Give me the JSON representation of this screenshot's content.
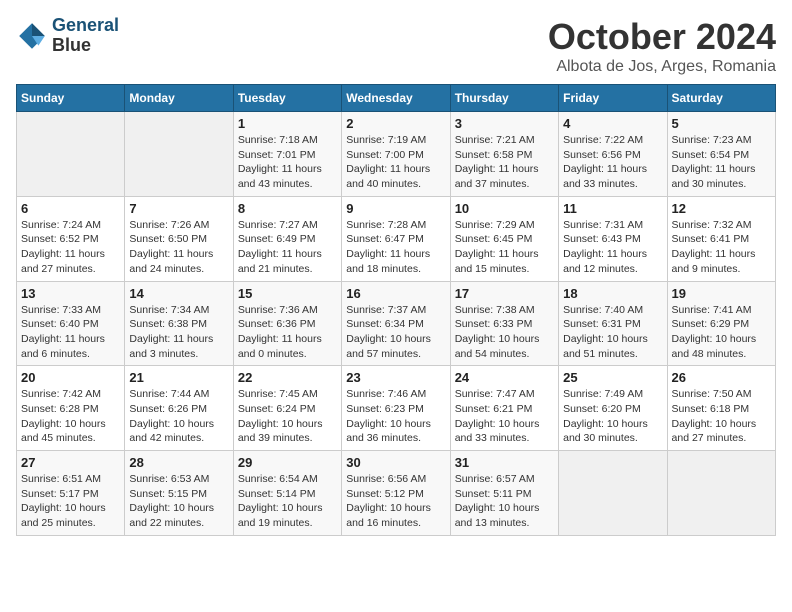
{
  "header": {
    "logo_line1": "General",
    "logo_line2": "Blue",
    "month": "October 2024",
    "location": "Albota de Jos, Arges, Romania"
  },
  "weekdays": [
    "Sunday",
    "Monday",
    "Tuesday",
    "Wednesday",
    "Thursday",
    "Friday",
    "Saturday"
  ],
  "weeks": [
    [
      {
        "day": "",
        "info": ""
      },
      {
        "day": "",
        "info": ""
      },
      {
        "day": "1",
        "info": "Sunrise: 7:18 AM\nSunset: 7:01 PM\nDaylight: 11 hours and 43 minutes."
      },
      {
        "day": "2",
        "info": "Sunrise: 7:19 AM\nSunset: 7:00 PM\nDaylight: 11 hours and 40 minutes."
      },
      {
        "day": "3",
        "info": "Sunrise: 7:21 AM\nSunset: 6:58 PM\nDaylight: 11 hours and 37 minutes."
      },
      {
        "day": "4",
        "info": "Sunrise: 7:22 AM\nSunset: 6:56 PM\nDaylight: 11 hours and 33 minutes."
      },
      {
        "day": "5",
        "info": "Sunrise: 7:23 AM\nSunset: 6:54 PM\nDaylight: 11 hours and 30 minutes."
      }
    ],
    [
      {
        "day": "6",
        "info": "Sunrise: 7:24 AM\nSunset: 6:52 PM\nDaylight: 11 hours and 27 minutes."
      },
      {
        "day": "7",
        "info": "Sunrise: 7:26 AM\nSunset: 6:50 PM\nDaylight: 11 hours and 24 minutes."
      },
      {
        "day": "8",
        "info": "Sunrise: 7:27 AM\nSunset: 6:49 PM\nDaylight: 11 hours and 21 minutes."
      },
      {
        "day": "9",
        "info": "Sunrise: 7:28 AM\nSunset: 6:47 PM\nDaylight: 11 hours and 18 minutes."
      },
      {
        "day": "10",
        "info": "Sunrise: 7:29 AM\nSunset: 6:45 PM\nDaylight: 11 hours and 15 minutes."
      },
      {
        "day": "11",
        "info": "Sunrise: 7:31 AM\nSunset: 6:43 PM\nDaylight: 11 hours and 12 minutes."
      },
      {
        "day": "12",
        "info": "Sunrise: 7:32 AM\nSunset: 6:41 PM\nDaylight: 11 hours and 9 minutes."
      }
    ],
    [
      {
        "day": "13",
        "info": "Sunrise: 7:33 AM\nSunset: 6:40 PM\nDaylight: 11 hours and 6 minutes."
      },
      {
        "day": "14",
        "info": "Sunrise: 7:34 AM\nSunset: 6:38 PM\nDaylight: 11 hours and 3 minutes."
      },
      {
        "day": "15",
        "info": "Sunrise: 7:36 AM\nSunset: 6:36 PM\nDaylight: 11 hours and 0 minutes."
      },
      {
        "day": "16",
        "info": "Sunrise: 7:37 AM\nSunset: 6:34 PM\nDaylight: 10 hours and 57 minutes."
      },
      {
        "day": "17",
        "info": "Sunrise: 7:38 AM\nSunset: 6:33 PM\nDaylight: 10 hours and 54 minutes."
      },
      {
        "day": "18",
        "info": "Sunrise: 7:40 AM\nSunset: 6:31 PM\nDaylight: 10 hours and 51 minutes."
      },
      {
        "day": "19",
        "info": "Sunrise: 7:41 AM\nSunset: 6:29 PM\nDaylight: 10 hours and 48 minutes."
      }
    ],
    [
      {
        "day": "20",
        "info": "Sunrise: 7:42 AM\nSunset: 6:28 PM\nDaylight: 10 hours and 45 minutes."
      },
      {
        "day": "21",
        "info": "Sunrise: 7:44 AM\nSunset: 6:26 PM\nDaylight: 10 hours and 42 minutes."
      },
      {
        "day": "22",
        "info": "Sunrise: 7:45 AM\nSunset: 6:24 PM\nDaylight: 10 hours and 39 minutes."
      },
      {
        "day": "23",
        "info": "Sunrise: 7:46 AM\nSunset: 6:23 PM\nDaylight: 10 hours and 36 minutes."
      },
      {
        "day": "24",
        "info": "Sunrise: 7:47 AM\nSunset: 6:21 PM\nDaylight: 10 hours and 33 minutes."
      },
      {
        "day": "25",
        "info": "Sunrise: 7:49 AM\nSunset: 6:20 PM\nDaylight: 10 hours and 30 minutes."
      },
      {
        "day": "26",
        "info": "Sunrise: 7:50 AM\nSunset: 6:18 PM\nDaylight: 10 hours and 27 minutes."
      }
    ],
    [
      {
        "day": "27",
        "info": "Sunrise: 6:51 AM\nSunset: 5:17 PM\nDaylight: 10 hours and 25 minutes."
      },
      {
        "day": "28",
        "info": "Sunrise: 6:53 AM\nSunset: 5:15 PM\nDaylight: 10 hours and 22 minutes."
      },
      {
        "day": "29",
        "info": "Sunrise: 6:54 AM\nSunset: 5:14 PM\nDaylight: 10 hours and 19 minutes."
      },
      {
        "day": "30",
        "info": "Sunrise: 6:56 AM\nSunset: 5:12 PM\nDaylight: 10 hours and 16 minutes."
      },
      {
        "day": "31",
        "info": "Sunrise: 6:57 AM\nSunset: 5:11 PM\nDaylight: 10 hours and 13 minutes."
      },
      {
        "day": "",
        "info": ""
      },
      {
        "day": "",
        "info": ""
      }
    ]
  ]
}
